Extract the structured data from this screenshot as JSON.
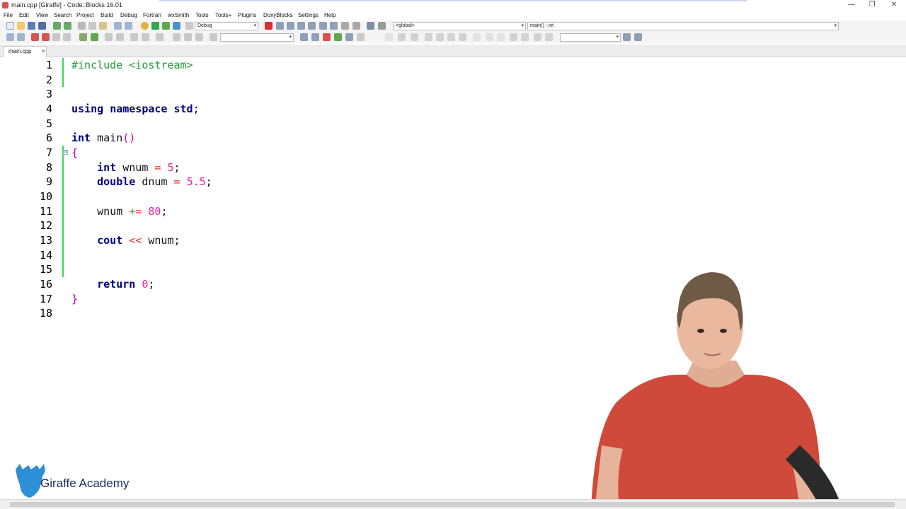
{
  "window": {
    "title": "main.cpp [Giraffe] - Code::Blocks 16.01",
    "minimize_glyph": "—",
    "restore_glyph": "❐",
    "close_glyph": "✕"
  },
  "menu": [
    "File",
    "Edit",
    "View",
    "Search",
    "Project",
    "Build",
    "Debug",
    "Fortran",
    "wxSmith",
    "Tools",
    "Tools+",
    "Plugins",
    "DoxyBlocks",
    "Settings",
    "Help"
  ],
  "toolbar": {
    "build_target": "Debug",
    "scope": "<global>",
    "symbol": "main() : int"
  },
  "tabs": [
    {
      "label": "main.cpp",
      "close": "✕"
    }
  ],
  "editor": {
    "fold_marker": "⊟",
    "lines": [
      {
        "n": "1",
        "tokens": [
          [
            "pp",
            "#include <iostream>"
          ]
        ]
      },
      {
        "n": "2",
        "tokens": []
      },
      {
        "n": "3",
        "tokens": []
      },
      {
        "n": "4",
        "tokens": [
          [
            "kw",
            "using"
          ],
          [
            "",
            " "
          ],
          [
            "kw",
            "namespace"
          ],
          [
            "",
            " "
          ],
          [
            "kw",
            "std"
          ],
          [
            "",
            ";"
          ]
        ]
      },
      {
        "n": "5",
        "tokens": []
      },
      {
        "n": "6",
        "tokens": [
          [
            "kw",
            "int"
          ],
          [
            "",
            " main"
          ],
          [
            "br",
            "()"
          ]
        ]
      },
      {
        "n": "7",
        "tokens": [
          [
            "br",
            "{"
          ]
        ]
      },
      {
        "n": "8",
        "tokens": [
          [
            "",
            "    "
          ],
          [
            "kw",
            "int"
          ],
          [
            "",
            " wnum "
          ],
          [
            "op",
            "="
          ],
          [
            "",
            " "
          ],
          [
            "num",
            "5"
          ],
          [
            "",
            ";"
          ]
        ]
      },
      {
        "n": "9",
        "tokens": [
          [
            "",
            "    "
          ],
          [
            "kw",
            "double"
          ],
          [
            "",
            " dnum "
          ],
          [
            "op",
            "="
          ],
          [
            "",
            " "
          ],
          [
            "num",
            "5.5"
          ],
          [
            "",
            ";"
          ]
        ]
      },
      {
        "n": "10",
        "tokens": []
      },
      {
        "n": "11",
        "tokens": [
          [
            "",
            "    wnum "
          ],
          [
            "op",
            "+="
          ],
          [
            "",
            " "
          ],
          [
            "num",
            "80"
          ],
          [
            "",
            ";"
          ]
        ]
      },
      {
        "n": "12",
        "tokens": []
      },
      {
        "n": "13",
        "tokens": [
          [
            "",
            "    "
          ],
          [
            "kw",
            "cout"
          ],
          [
            "",
            " "
          ],
          [
            "op",
            "<<"
          ],
          [
            "",
            " wnum;"
          ]
        ]
      },
      {
        "n": "14",
        "tokens": []
      },
      {
        "n": "15",
        "tokens": []
      },
      {
        "n": "16",
        "tokens": [
          [
            "",
            "    "
          ],
          [
            "kw",
            "return"
          ],
          [
            "",
            " "
          ],
          [
            "num",
            "0"
          ],
          [
            "",
            ";"
          ]
        ]
      },
      {
        "n": "17",
        "tokens": [
          [
            "br",
            "}"
          ]
        ]
      },
      {
        "n": "18",
        "tokens": []
      }
    ]
  },
  "watermark": {
    "text": "Giraffe Academy"
  },
  "colors": {
    "changed_line_marker": "#3ed65a",
    "keyword": "#000080",
    "number": "#f0209f",
    "operator": "#ef2d2d",
    "preprocessor": "#1e9a3a"
  }
}
